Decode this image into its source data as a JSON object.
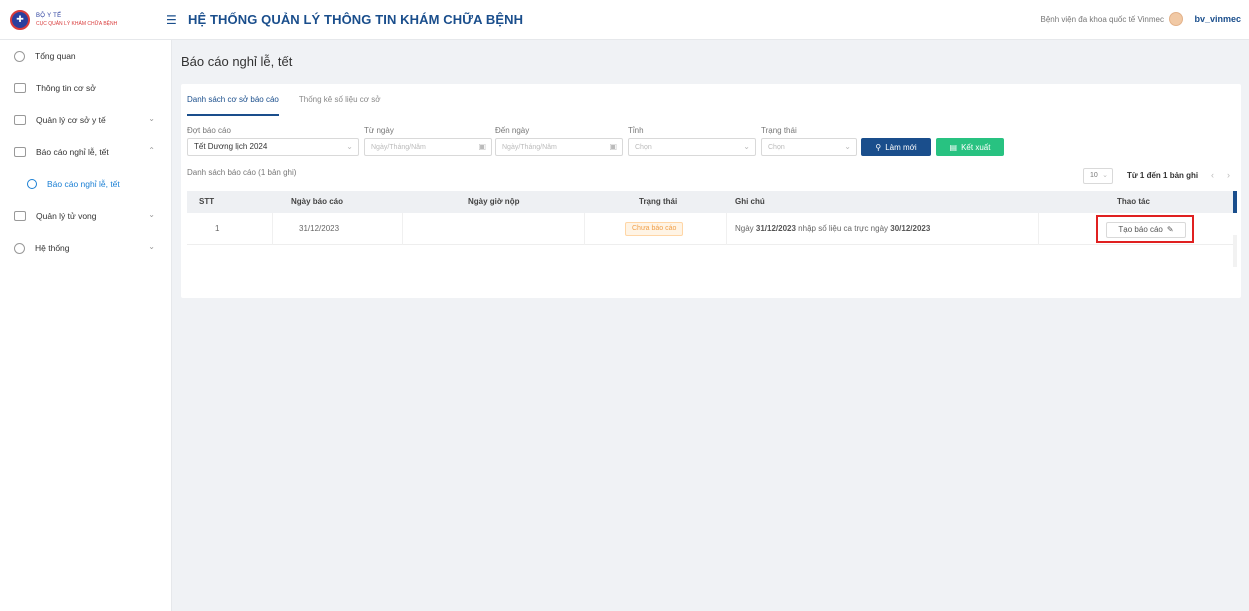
{
  "header": {
    "logo_line1": "BỘ Y TẾ",
    "logo_line2": "CỤC QUẢN LÝ KHÁM CHỮA BỆNH",
    "app_title": "HỆ THỐNG QUẢN LÝ THÔNG TIN KHÁM CHỮA BỆNH",
    "hospital": "Bệnh viện đa khoa quốc tế Vinmec",
    "username": "bv_vinmec"
  },
  "sidebar": {
    "items": [
      {
        "label": "Tổng quan"
      },
      {
        "label": "Thông tin cơ sở"
      },
      {
        "label": "Quản lý cơ sở y tế"
      },
      {
        "label": "Báo cáo nghỉ lễ, tết"
      },
      {
        "label": "Báo cáo nghỉ lễ, tết"
      },
      {
        "label": "Quản lý tử vong"
      },
      {
        "label": "Hệ thống"
      }
    ]
  },
  "page": {
    "title": "Báo cáo nghỉ lễ, tết",
    "tabs": [
      {
        "label": "Danh sách cơ sở báo cáo"
      },
      {
        "label": "Thống kê số liệu cơ sở"
      }
    ]
  },
  "filters": {
    "period_label": "Đợt báo cáo",
    "period_value": "Tết Dương lịch 2024",
    "from_label": "Từ ngày",
    "from_placeholder": "Ngày/Tháng/Năm",
    "to_label": "Đến ngày",
    "to_placeholder": "Ngày/Tháng/Năm",
    "province_label": "Tỉnh",
    "province_placeholder": "Chọn",
    "status_label": "Trạng thái",
    "status_placeholder": "Chọn",
    "refresh_label": "Làm mới",
    "export_label": "Kết xuất"
  },
  "list": {
    "caption": "Danh sách báo cáo (1 bản ghi)",
    "page_size": "10",
    "page_info": "Từ 1 đến 1 bản ghi"
  },
  "table": {
    "headers": {
      "stt": "STT",
      "report_date": "Ngày báo cáo",
      "submit_time": "Ngày giờ nộp",
      "status": "Trạng thái",
      "note": "Ghi chú",
      "action": "Thao tác"
    },
    "rows": [
      {
        "stt": "1",
        "report_date": "31/12/2023",
        "submit_time": "",
        "status": "Chưa báo cáo",
        "note_prefix": "Ngày ",
        "note_date1": "31/12/2023",
        "note_mid": " nhập số liệu ca trực ngày ",
        "note_date2": "30/12/2023",
        "action_label": "Tạo báo cáo"
      }
    ]
  },
  "colors": {
    "primary": "#1a4e8c",
    "success": "#28c281",
    "highlight": "#e02020",
    "badge": "#f0a04b"
  }
}
